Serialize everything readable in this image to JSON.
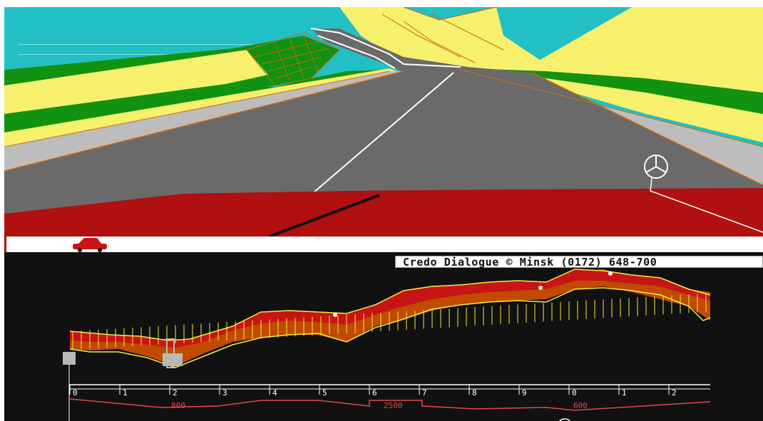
{
  "banner": {
    "text": "Credo Dialogue © Minsk (0172) 648-700"
  },
  "profile": {
    "km_labels": [
      "0",
      "1",
      "2",
      "3",
      "4",
      "5",
      "6",
      "7",
      "8",
      "9",
      "0",
      "1",
      "2"
    ],
    "speed_limits": [
      "800",
      "2500",
      "600"
    ]
  },
  "colors": {
    "sky": "#22c0c4",
    "grass": "#119211",
    "sand": "#f7f06c",
    "road": "#6a6a6a",
    "shoulder": "#bdbdbd",
    "hood": "#b01010",
    "terrain_fill": "#c04a00",
    "terrain_red": "#c81414",
    "wire": "#f4ec40"
  },
  "icons": {
    "car_marker": "red-car-icon",
    "hood_ornament": "star-emblem-icon"
  }
}
